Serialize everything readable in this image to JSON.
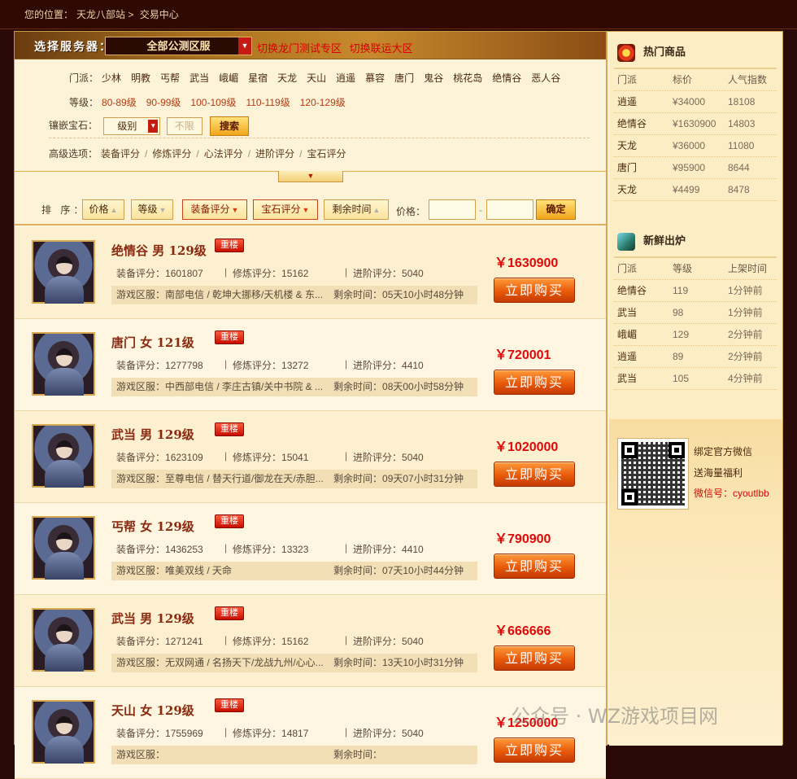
{
  "breadcrumb": {
    "prefix": "您的位置：",
    "site": "天龙八部站",
    "sep": ">",
    "page": "交易中心"
  },
  "server": {
    "label": "选择服务器：",
    "selected": "全部公测区服",
    "links": [
      "切换龙门测试专区",
      "切换联运大区"
    ]
  },
  "filters": {
    "sect_label": "门派：",
    "sects": [
      "少林",
      "明教",
      "丐帮",
      "武当",
      "峨嵋",
      "星宿",
      "天龙",
      "天山",
      "逍遥",
      "慕容",
      "唐门",
      "鬼谷",
      "桃花岛",
      "绝情谷",
      "恶人谷"
    ],
    "level_label": "等级：",
    "levels": [
      "80-89级",
      "90-99级",
      "100-109级",
      "110-119级",
      "120-129级"
    ],
    "gem_label": "镶嵌宝石：",
    "gem_select": "级别",
    "gem_input": "不限",
    "search_button": "搜索",
    "advanced_label": "高级选项：",
    "advanced": [
      "装备评分",
      "修炼评分",
      "心法评分",
      "进阶评分",
      "宝石评分"
    ],
    "advanced_sep": "/"
  },
  "sort": {
    "label": "排 序：",
    "buttons": [
      {
        "label": "价格",
        "dir": "up",
        "active": false
      },
      {
        "label": "等级",
        "dir": "down",
        "active": false
      },
      {
        "label": "装备评分",
        "dir": "down",
        "active": true
      },
      {
        "label": "宝石评分",
        "dir": "down",
        "active": true
      },
      {
        "label": "剩余时间",
        "dir": "up",
        "active": false
      }
    ],
    "price_label": "价格：",
    "dash": "-",
    "ok_button": "确定"
  },
  "listing_labels": {
    "equip": "装备评分：",
    "cultivate": "修炼评分：",
    "advance": "进阶评分：",
    "zone": "游戏区服：",
    "time": "剩余时间：",
    "badge": "重楼",
    "buy": "立即购买",
    "currency": "￥"
  },
  "listings": [
    {
      "title": "绝情谷  男  129级",
      "equip": "1601807",
      "cultivate": "15162",
      "advance": "5040",
      "zone": "南部电信 / 乾坤大挪移/天机楼 & 东...",
      "time": "05天10小时48分钟",
      "price": "1630900"
    },
    {
      "title": "唐门  女  121级",
      "equip": "1277798",
      "cultivate": "13272",
      "advance": "4410",
      "zone": "中西部电信 / 李庄古镇/关中书院 & ...",
      "time": "08天00小时58分钟",
      "price": "720001"
    },
    {
      "title": "武当  男  129级",
      "equip": "1623109",
      "cultivate": "15041",
      "advance": "5040",
      "zone": "至尊电信 / 替天行道/御龙在天/赤胆...",
      "time": "09天07小时31分钟",
      "price": "1020000"
    },
    {
      "title": "丐帮  女  129级",
      "equip": "1436253",
      "cultivate": "13323",
      "advance": "4410",
      "zone": "唯美双线 / 天命",
      "time": "07天10小时44分钟",
      "price": "790900"
    },
    {
      "title": "武当  男  129级",
      "equip": "1271241",
      "cultivate": "15162",
      "advance": "5040",
      "zone": "无双网通 / 名扬天下/龙战九州/心心...",
      "time": "13天10小时31分钟",
      "price": "666666"
    },
    {
      "title": "天山  女  129级",
      "equip": "1755969",
      "cultivate": "14817",
      "advance": "5040",
      "zone": "",
      "time": "",
      "price": "1250000"
    }
  ],
  "sidebar": {
    "hot_title": "热门商品",
    "hot_headers": [
      "门派",
      "标价",
      "人气指数"
    ],
    "hot_rows": [
      [
        "逍遥",
        "¥34000",
        "18108"
      ],
      [
        "绝情谷",
        "¥1630900",
        "14803"
      ],
      [
        "天龙",
        "¥36000",
        "11080"
      ],
      [
        "唐门",
        "¥95900",
        "8644"
      ],
      [
        "天龙",
        "¥4499",
        "8478"
      ]
    ],
    "new_title": "新鲜出炉",
    "new_headers": [
      "门派",
      "等级",
      "上架时间"
    ],
    "new_rows": [
      [
        "绝情谷",
        "119",
        "1分钟前"
      ],
      [
        "武当",
        "98",
        "1分钟前"
      ],
      [
        "峨嵋",
        "129",
        "2分钟前"
      ],
      [
        "逍遥",
        "89",
        "2分钟前"
      ],
      [
        "武当",
        "105",
        "4分钟前"
      ]
    ],
    "wechat": [
      "绑定官方微信",
      "送海量福利",
      "微信号：cyoutlbb"
    ]
  },
  "watermark": "公众号 · WZ游戏项目网",
  "colors": {
    "accent": "#e00808",
    "frame": "#2a0a06",
    "panel": "#fdf3d8",
    "buy": "#e85a0a"
  }
}
